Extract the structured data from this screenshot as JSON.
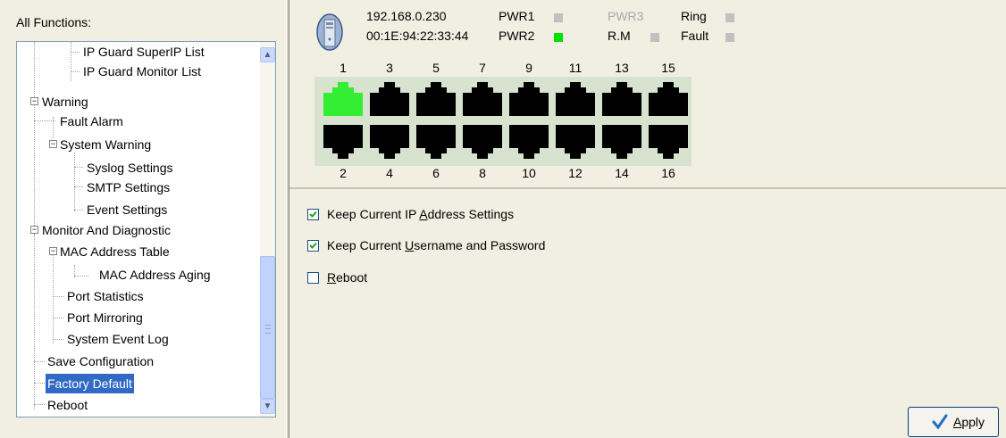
{
  "sidebar": {
    "title": "All Functions:",
    "items": [
      {
        "label": "IP Guard SuperIP List"
      },
      {
        "label": "IP Guard Monitor List"
      },
      {
        "label": "Warning"
      },
      {
        "label": "Fault Alarm"
      },
      {
        "label": "System Warning"
      },
      {
        "label": "Syslog Settings"
      },
      {
        "label": "SMTP Settings"
      },
      {
        "label": "Event Settings"
      },
      {
        "label": "Monitor And Diagnostic"
      },
      {
        "label": "MAC Address Table"
      },
      {
        "label": "MAC Address Aging"
      },
      {
        "label": "Port Statistics"
      },
      {
        "label": "Port Mirroring"
      },
      {
        "label": "System Event Log"
      },
      {
        "label": "Save Configuration"
      },
      {
        "label": "Factory Default",
        "selected": true
      },
      {
        "label": "Reboot"
      }
    ]
  },
  "device": {
    "ip": "192.168.0.230",
    "mac": "00:1E:94:22:33:44",
    "indicators": [
      {
        "label": "PWR1",
        "state": "off"
      },
      {
        "label": "PWR2",
        "state": "on"
      },
      {
        "label": "PWR3",
        "state": "disabled"
      },
      {
        "label": "R.M",
        "state": "off"
      },
      {
        "label": "Ring",
        "state": "off"
      },
      {
        "label": "Fault",
        "state": "off"
      }
    ],
    "ports_top": [
      "1",
      "3",
      "5",
      "7",
      "9",
      "11",
      "13",
      "15"
    ],
    "ports_bottom": [
      "2",
      "4",
      "6",
      "8",
      "10",
      "12",
      "14",
      "16"
    ],
    "active_ports": [
      "1"
    ],
    "colors": {
      "active": "#33ee33",
      "inactive": "#000000",
      "panel": "#d7e3cf"
    }
  },
  "options": {
    "keep_ip": {
      "pre": "Keep Current IP ",
      "key": "A",
      "post": "ddress Settings",
      "checked": true
    },
    "keep_user": {
      "pre": "Keep Current ",
      "key": "U",
      "post": "sername and Password",
      "checked": true
    },
    "reboot": {
      "pre": "",
      "key": "R",
      "post": "eboot",
      "checked": false
    }
  },
  "apply_button": {
    "key": "A",
    "post": "pply"
  },
  "icons": [
    "pc-tower-icon",
    "checkmark-icon",
    "scroll-up-icon",
    "scroll-down-icon",
    "expander-minus-icon"
  ]
}
